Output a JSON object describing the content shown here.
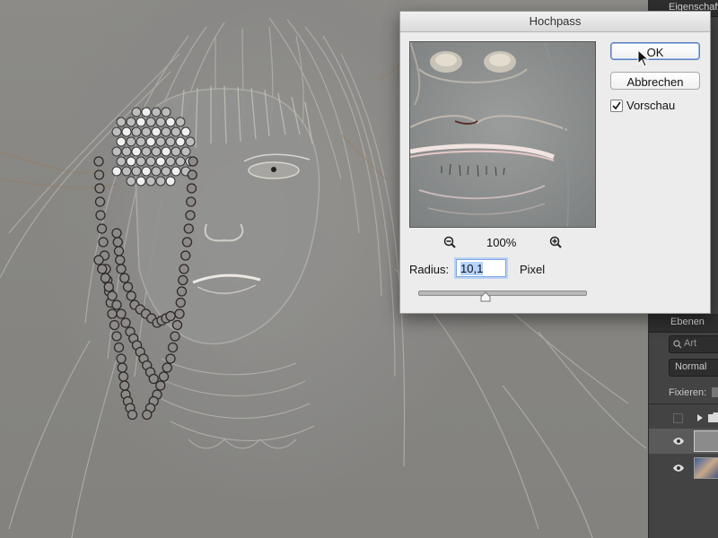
{
  "dialog": {
    "title": "Hochpass",
    "ok_label": "OK",
    "cancel_label": "Abbrechen",
    "preview_label": "Vorschau",
    "preview_checked": true,
    "zoom_level": "100%",
    "radius_label": "Radius:",
    "radius_value": "10,1",
    "radius_unit": "Pixel",
    "radius_slider_fraction": 0.4,
    "icons": [
      "zoom-out-icon",
      "zoom-in-icon",
      "check-icon",
      "slider-thumb-icon"
    ]
  },
  "right_panel": {
    "properties_tab": "Eigenschaften",
    "layers_tab": "Ebenen",
    "layers_search_value": "Art",
    "blend_mode": "Normal",
    "lock_label": "Fixieren:",
    "icons": [
      "search-icon",
      "eye-icon",
      "folder-icon",
      "disclosure-triangle-icon"
    ]
  },
  "colors": {
    "accent_blue": "#5b7fb7",
    "selection_blue": "#b5d3ff",
    "panel_dark": "#434343",
    "dialog_bg": "#ececec"
  }
}
